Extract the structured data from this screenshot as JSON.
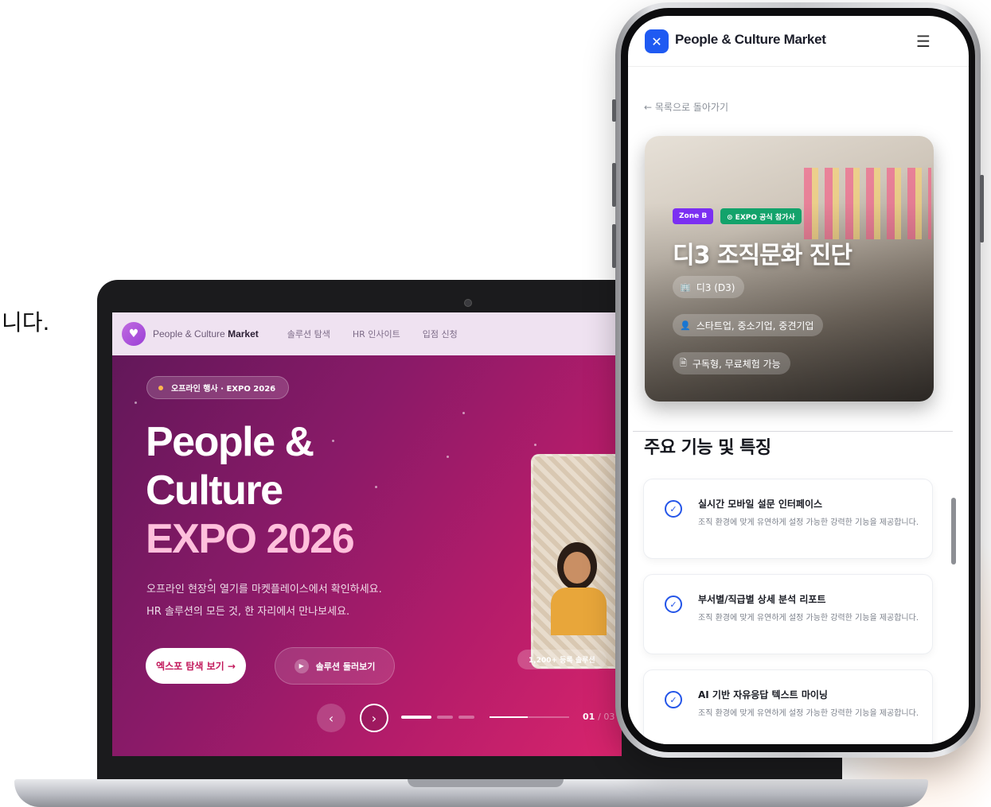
{
  "stray_text": "니다.",
  "laptop": {
    "nav": {
      "brand_prefix": "People & Culture",
      "brand_bold": "Market",
      "links": [
        "솔루션 탐색",
        "HR 인사이트",
        "입점 신청"
      ]
    },
    "hero": {
      "badge": "오프라인 행사 · EXPO 2026",
      "title_line1": "People &",
      "title_line2": "Culture",
      "title_line3": "EXPO 2026",
      "desc_line1": "오프라인 현장의 열기를 마켓플레이스에서 확인하세요.",
      "desc_line2": "HR 솔루션의 모든 것, 한 자리에서 만나보세요.",
      "primary_button": "엑스포 탐색 보기 →",
      "secondary_button": "솔루션 둘러보기",
      "count_badge": "1,200+ 등록 솔루션"
    },
    "carousel": {
      "prev": "‹",
      "next": "›",
      "current": "01",
      "total": "/ 03",
      "progress": 0.48
    }
  },
  "phone": {
    "header": {
      "logo_glyph": "✕",
      "brand": "People & Culture Market",
      "menu_glyph": "☰"
    },
    "back_link": "← 목록으로 돌아가기",
    "hero": {
      "tag_zone": "Zone B",
      "tag_expo": "⊙ EXPO 공식 참가사",
      "title": "디3 조직문화 진단",
      "chips": [
        {
          "icon": "🏢",
          "icon_name": "building-icon",
          "label": "디3 (D3)"
        },
        {
          "icon": "👤",
          "icon_name": "person-icon",
          "label": "스타트업, 중소기업, 중견기업"
        },
        {
          "icon": "🗎",
          "icon_name": "document-icon",
          "label": "구독형, 무료체험 가능"
        }
      ]
    },
    "section_title": "주요 기능 및 특징",
    "features": [
      {
        "title": "실시간 모바일 설문 인터페이스",
        "desc": "조직 환경에 맞게 유연하게 설정 가능한 강력한 기능을 제공합니다."
      },
      {
        "title": "부서별/직급별 상세 분석 리포트",
        "desc": "조직 환경에 맞게 유연하게 설정 가능한 강력한 기능을 제공합니다."
      },
      {
        "title": "AI 기반 자유응답 텍스트 마이닝",
        "desc": "조직 환경에 맞게 유연하게 설정 가능한 강력한 기능을 제공합니다."
      }
    ]
  },
  "colors": {
    "accent_blue": "#1f5af2",
    "hero_magenta": "#b41c6a",
    "tag_purple": "#7b2ff2",
    "tag_green": "#13a36b"
  }
}
